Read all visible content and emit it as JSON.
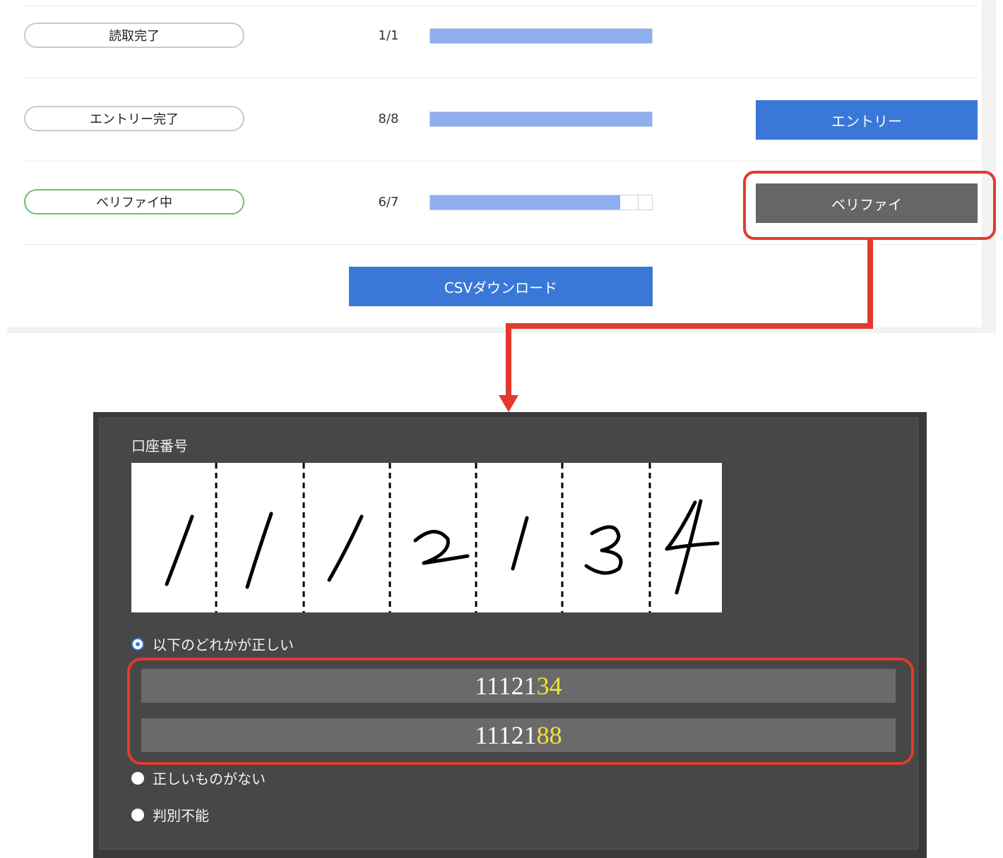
{
  "rows": [
    {
      "status": "読取完了",
      "count": "1/1",
      "progress": 1.0,
      "active": false
    },
    {
      "status": "エントリー完了",
      "count": "8/8",
      "progress": 1.0,
      "active": false,
      "action": "エントリー"
    },
    {
      "status": "ベリファイ中",
      "count": "6/7",
      "progress": 0.857,
      "active": true,
      "action": "ベリファイ"
    }
  ],
  "csv_button": "CSVダウンロード",
  "verify": {
    "field_label": "口座番号",
    "digit_image": {
      "digits": "1112134"
    },
    "options": {
      "one_correct": "以下のどれかが正しい",
      "none_correct": "正しいものがない",
      "undeterminable": "判別不能"
    },
    "candidates": [
      {
        "prefix": "11121",
        "highlight": "34"
      },
      {
        "prefix": "11121",
        "highlight": "88"
      }
    ]
  },
  "colors": {
    "accent_blue": "#3a78d8",
    "progress_fill": "#8eaef0",
    "annotation_red": "#e33a2f",
    "active_green": "#6cbf6a",
    "highlight_yellow": "#f0e040"
  }
}
